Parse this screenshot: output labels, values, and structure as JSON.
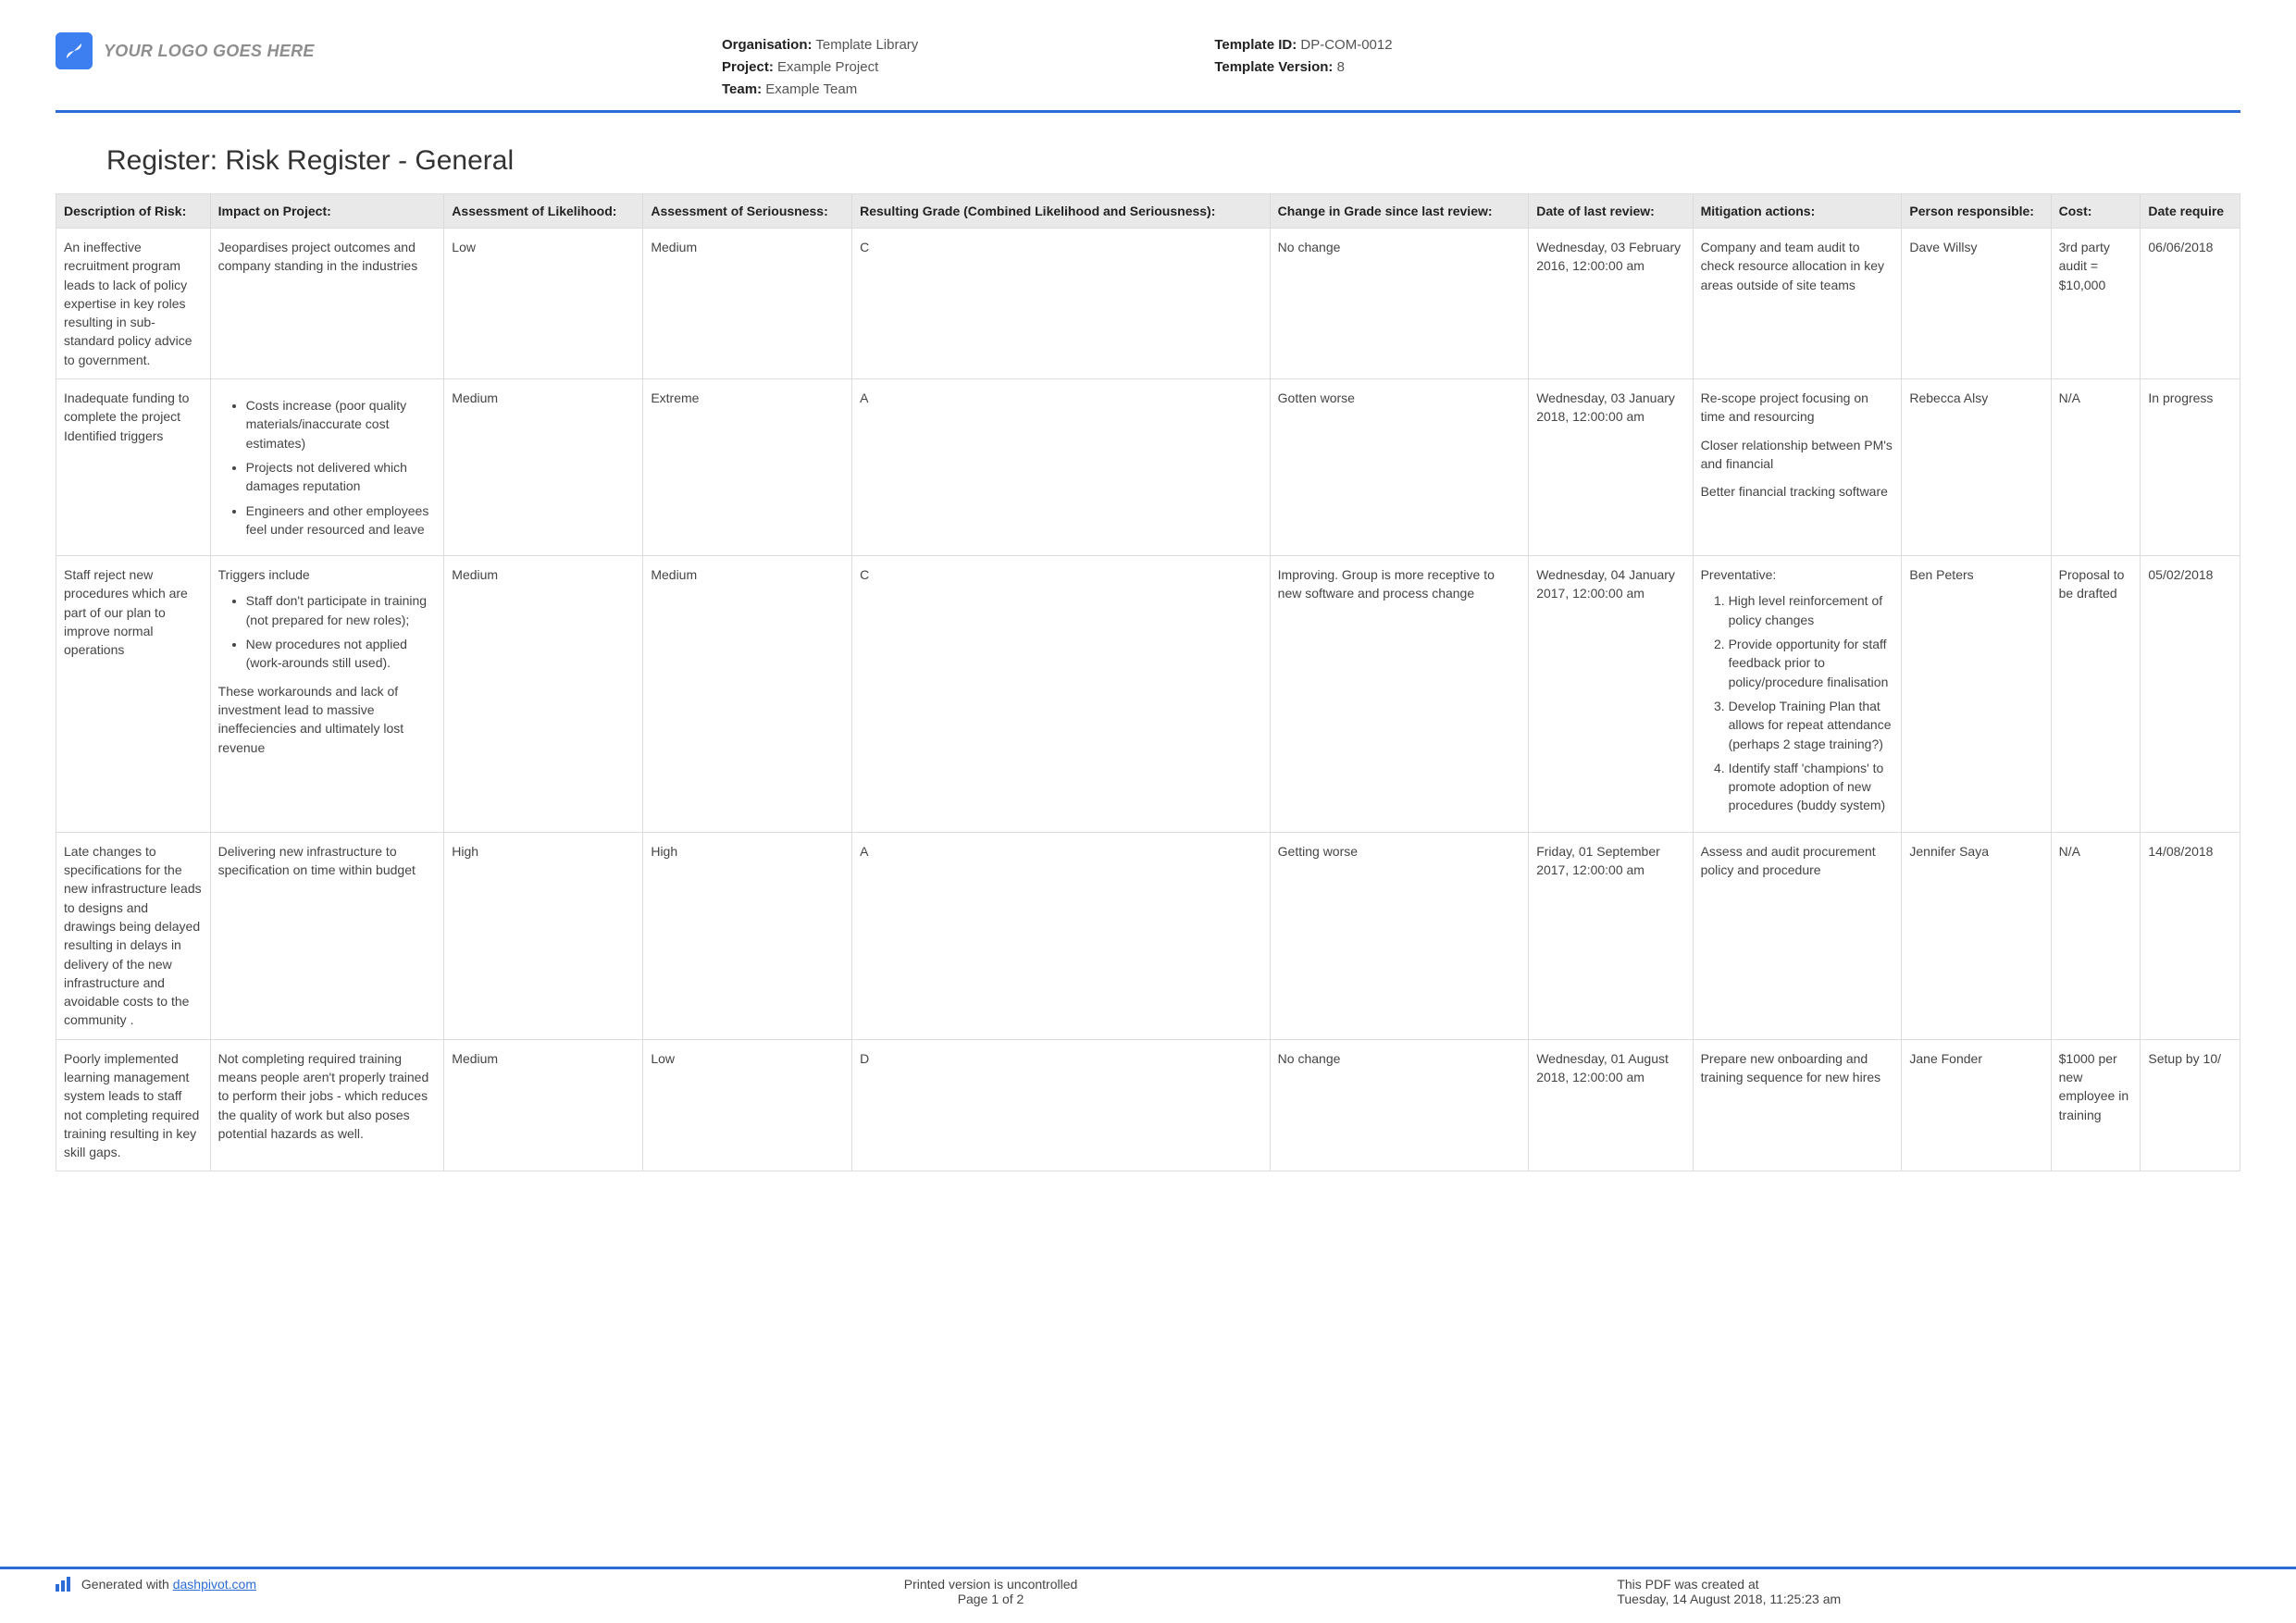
{
  "header": {
    "logo_text": "YOUR LOGO GOES HERE",
    "org_label": "Organisation:",
    "org": "Template Library",
    "project_label": "Project:",
    "project": "Example Project",
    "team_label": "Team:",
    "team": "Example Team",
    "template_id_label": "Template ID:",
    "template_id": "DP-COM-0012",
    "template_version_label": "Template Version:",
    "template_version": "8"
  },
  "title": "Register: Risk Register - General",
  "columns": [
    "Description of Risk:",
    "Impact on Project:",
    "Assessment of Likelihood:",
    "Assessment of Seriousness:",
    "Resulting Grade (Combined Likelihood and Seriousness):",
    "Change in Grade since last review:",
    "Date of last review:",
    "Mitigation actions:",
    "Person responsible:",
    "Cost:",
    "Date require"
  ],
  "rows": [
    {
      "desc": "An ineffective recruitment program leads to lack of policy expertise in key roles resulting in sub-standard policy advice to government.",
      "impact": "Jeopardises project outcomes and company standing in the industries",
      "likelihood": "Low",
      "seriousness": "Medium",
      "grade": "C",
      "change": "No change",
      "last_review": "Wednesday, 03 February 2016, 12:00:00 am",
      "mitigation": "Company and team audit to check resource allocation in key areas outside of site teams",
      "responsible": "Dave Willsy",
      "cost": "3rd party audit = $10,000",
      "date_required": "06/06/2018"
    },
    {
      "desc": "Inadequate funding to complete the project Identified triggers",
      "impact_bullets": [
        "Costs increase (poor quality materials/inaccurate cost estimates)",
        "Projects not delivered which damages reputation",
        "Engineers and other employees feel under resourced and leave"
      ],
      "likelihood": "Medium",
      "seriousness": "Extreme",
      "grade": "A",
      "change": "Gotten worse",
      "last_review": "Wednesday, 03 January 2018, 12:00:00 am",
      "mitigation_paras": [
        "Re-scope project focusing on time and resourcing",
        "Closer relationship between PM's and financial",
        "Better financial tracking software"
      ],
      "responsible": "Rebecca Alsy",
      "cost": "N/A",
      "date_required": "In progress"
    },
    {
      "desc": "Staff reject new procedures which are part of our plan to improve normal operations",
      "impact_intro": "Triggers include",
      "impact_bullets": [
        "Staff don't participate in training (not prepared for new roles);",
        "New procedures not applied (work-arounds still used)."
      ],
      "impact_outro": "These workarounds and lack of investment lead to massive ineffeciencies and ultimately lost revenue",
      "likelihood": "Medium",
      "seriousness": "Medium",
      "grade": "C",
      "change": "Improving. Group is more receptive to new software and process change",
      "last_review": "Wednesday, 04 January 2017, 12:00:00 am",
      "mitigation_intro": "Preventative:",
      "mitigation_list": [
        "High level reinforcement of policy changes",
        "Provide opportunity for staff feedback prior to policy/procedure finalisation",
        "Develop Training Plan that allows for repeat attendance (perhaps 2 stage training?)",
        "Identify staff 'champions' to promote adoption of new procedures (buddy system)"
      ],
      "responsible": "Ben Peters",
      "cost": "Proposal to be drafted",
      "date_required": "05/02/2018"
    },
    {
      "desc": "Late changes to specifications for the new infrastructure leads to designs and drawings being delayed resulting in delays in delivery of the new infrastructure and avoidable costs to the community .",
      "impact": "Delivering new infrastructure to specification on time within budget",
      "likelihood": "High",
      "seriousness": "High",
      "grade": "A",
      "change": "Getting worse",
      "last_review": "Friday, 01 September 2017, 12:00:00 am",
      "mitigation": "Assess and audit procurement policy and procedure",
      "responsible": "Jennifer Saya",
      "cost": "N/A",
      "date_required": "14/08/2018"
    },
    {
      "desc": "Poorly implemented learning management system leads to staff not completing required training resulting in key skill gaps.",
      "impact": "Not completing required training means people aren't properly trained to perform their jobs - which reduces the quality of work but also poses potential hazards as well.",
      "likelihood": "Medium",
      "seriousness": "Low",
      "grade": "D",
      "change": "No change",
      "last_review": "Wednesday, 01 August 2018, 12:00:00 am",
      "mitigation": "Prepare new onboarding and training sequence for new hires",
      "responsible": "Jane Fonder",
      "cost": "$1000 per new employee in training",
      "date_required": "Setup by 10/"
    }
  ],
  "footer": {
    "gen_prefix": "Generated with ",
    "gen_link": "dashpivot.com",
    "uncontrolled": "Printed version is uncontrolled",
    "page": "Page 1 of 2",
    "created_label": "This PDF was created at",
    "created_at": "Tuesday, 14 August 2018, 11:25:23 am"
  }
}
